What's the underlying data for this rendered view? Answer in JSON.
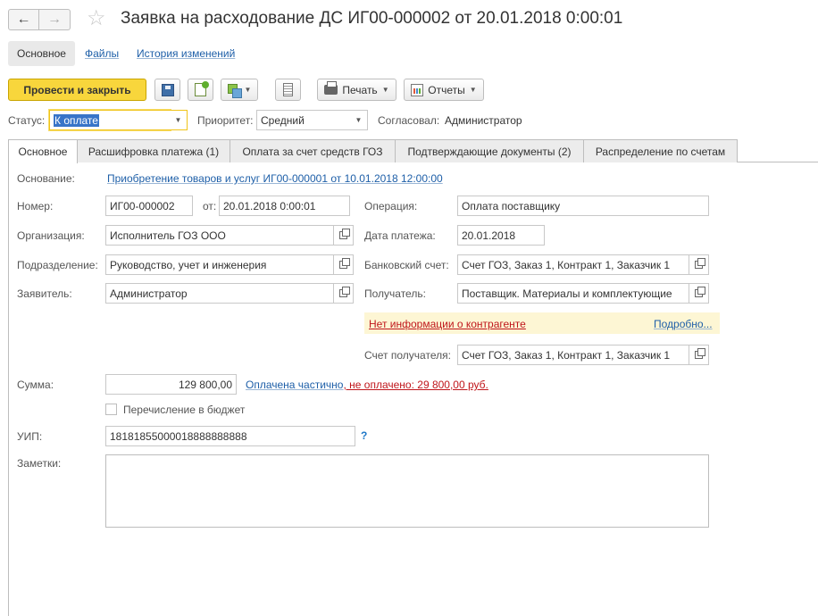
{
  "header": {
    "title": "Заявка на расходование ДС ИГ00-000002 от 20.01.2018 0:00:01",
    "back_glyph": "←",
    "forward_glyph": "→",
    "star_glyph": "☆"
  },
  "sections": {
    "main": "Основное",
    "files": "Файлы",
    "history": "История изменений"
  },
  "toolbar": {
    "post_close": "Провести и закрыть",
    "print": "Печать",
    "reports": "Отчеты",
    "icons": [
      "save-icon",
      "post-icon",
      "create-based-icon",
      "list-icon",
      "print-icon",
      "report-icon"
    ]
  },
  "status_row": {
    "status_label": "Статус:",
    "status_value": "К оплате",
    "priority_label": "Приоритет:",
    "priority_value": "Средний",
    "approved_label": "Согласовал:",
    "approved_value": "Администратор"
  },
  "tabs": [
    "Основное",
    "Расшифровка платежа (1)",
    "Оплата за счет средств ГОЗ",
    "Подтверждающие документы (2)",
    "Распределение по счетам"
  ],
  "form": {
    "basis_label": "Основание:",
    "basis_link": "Приобретение товаров и услуг ИГ00-000001 от 10.01.2018 12:00:00",
    "number_label": "Номер:",
    "number_value": "ИГ00-000002",
    "date_from_label": "от:",
    "date_value": "20.01.2018  0:00:01",
    "operation_label": "Операция:",
    "operation_value": "Оплата поставщику",
    "org_label": "Организация:",
    "org_value": "Исполнитель ГОЗ ООО",
    "pay_date_label": "Дата платежа:",
    "pay_date_value": "20.01.2018",
    "dept_label": "Подразделение:",
    "dept_value": "Руководство, учет и инженерия",
    "bank_label": "Банковский счет:",
    "bank_value": "Счет ГОЗ, Заказ 1, Контракт 1, Заказчик 1",
    "applicant_label": "Заявитель:",
    "applicant_value": "Администратор",
    "recipient_label": "Получатель:",
    "recipient_value": "Поставщик. Материалы и комплектующие",
    "no_info_link": "Нет информации о контрагенте",
    "details_link": "Подробно...",
    "recipient_account_label": "Счет получателя:",
    "recipient_account_value": "Счет ГОЗ, Заказ 1, Контракт 1, Заказчик 1",
    "sum_label": "Сумма:",
    "sum_value": "129 800,00",
    "paid_partially": "Оплачена частично",
    "unpaid_text": ", не оплачено: 29 800,00 руб.",
    "budget_label": "Перечисление в бюджет",
    "uip_label": "УИП:",
    "uip_value": "18181855000018888888888",
    "help_glyph": "?",
    "notes_label": "Заметки:"
  },
  "colors": {
    "primary_button": "#f8d63c",
    "link": "#1e5fa8",
    "warning_bg": "#fdf6d4",
    "warning_text": "#c0161b",
    "selection": "#3874c8"
  }
}
